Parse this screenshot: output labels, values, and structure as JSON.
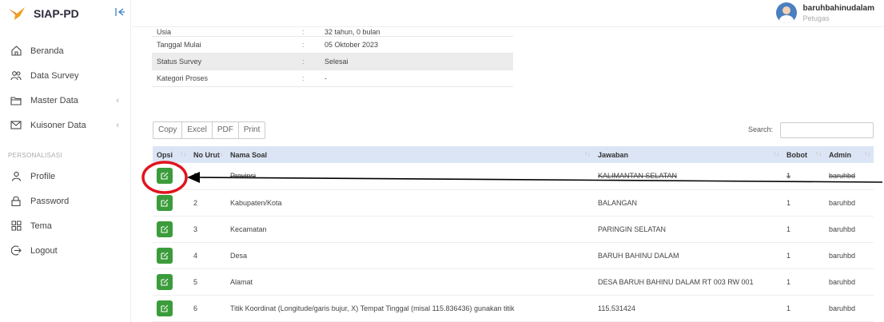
{
  "brand": {
    "name": "SIAP-PD",
    "collapse_icon": "collapse-left-icon"
  },
  "sidebar": {
    "items": [
      {
        "label": "Beranda",
        "icon": "home-icon",
        "chevron": ""
      },
      {
        "label": "Data Survey",
        "icon": "users-icon",
        "chevron": ""
      },
      {
        "label": "Master Data",
        "icon": "folder-icon",
        "chevron": "‹"
      },
      {
        "label": "Kuisoner Data",
        "icon": "mail-icon",
        "chevron": "‹"
      }
    ],
    "section_label": "PERSONALISASI",
    "personal_items": [
      {
        "label": "Profile",
        "icon": "user-icon"
      },
      {
        "label": "Password",
        "icon": "lock-icon"
      },
      {
        "label": "Tema",
        "icon": "grid-icon"
      },
      {
        "label": "Logout",
        "icon": "logout-icon"
      }
    ]
  },
  "user": {
    "name": "baruhbahinudalam",
    "role": "Petugas"
  },
  "info": {
    "rows": [
      {
        "key": "Usia",
        "colon": ":",
        "value": "32 tahun, 0 bulan"
      },
      {
        "key": "Tanggal Mulai",
        "colon": ":",
        "value": "05 Oktober 2023"
      },
      {
        "key": "Status Survey",
        "colon": ":",
        "value": "Selesai"
      },
      {
        "key": "Kategori Proses",
        "colon": ":",
        "value": "-"
      }
    ]
  },
  "export_buttons": [
    "Copy",
    "Excel",
    "PDF",
    "Print"
  ],
  "search": {
    "label": "Search:",
    "value": ""
  },
  "table": {
    "headers": [
      "Opsi",
      "No Urut",
      "Nama Soal",
      "Jawaban",
      "Bobot",
      "Admin"
    ],
    "rows": [
      {
        "no": "1",
        "soal": "Provinsi",
        "jawaban": "KALIMANTAN SELATAN",
        "bobot": "1",
        "admin": "baruhbd"
      },
      {
        "no": "2",
        "soal": "Kabupaten/Kota",
        "jawaban": "BALANGAN",
        "bobot": "1",
        "admin": "baruhbd"
      },
      {
        "no": "3",
        "soal": "Kecamatan",
        "jawaban": "PARINGIN SELATAN",
        "bobot": "1",
        "admin": "baruhbd"
      },
      {
        "no": "4",
        "soal": "Desa",
        "jawaban": "BARUH BAHINU DALAM",
        "bobot": "1",
        "admin": "baruhbd"
      },
      {
        "no": "5",
        "soal": "Alamat",
        "jawaban": "DESA BARUH BAHINU DALAM RT 003 RW 001",
        "bobot": "1",
        "admin": "baruhbd"
      },
      {
        "no": "6",
        "soal": "Titik Koordinat (Longitude/garis bujur, X) Tempat Tinggal (misal 115.836436) gunakan titik",
        "jawaban": "115.531424",
        "bobot": "1",
        "admin": "baruhbd"
      }
    ]
  },
  "colors": {
    "accent": "#3b9c3b",
    "header_bg": "#dbe5f5",
    "annotation": "#e0141e"
  }
}
